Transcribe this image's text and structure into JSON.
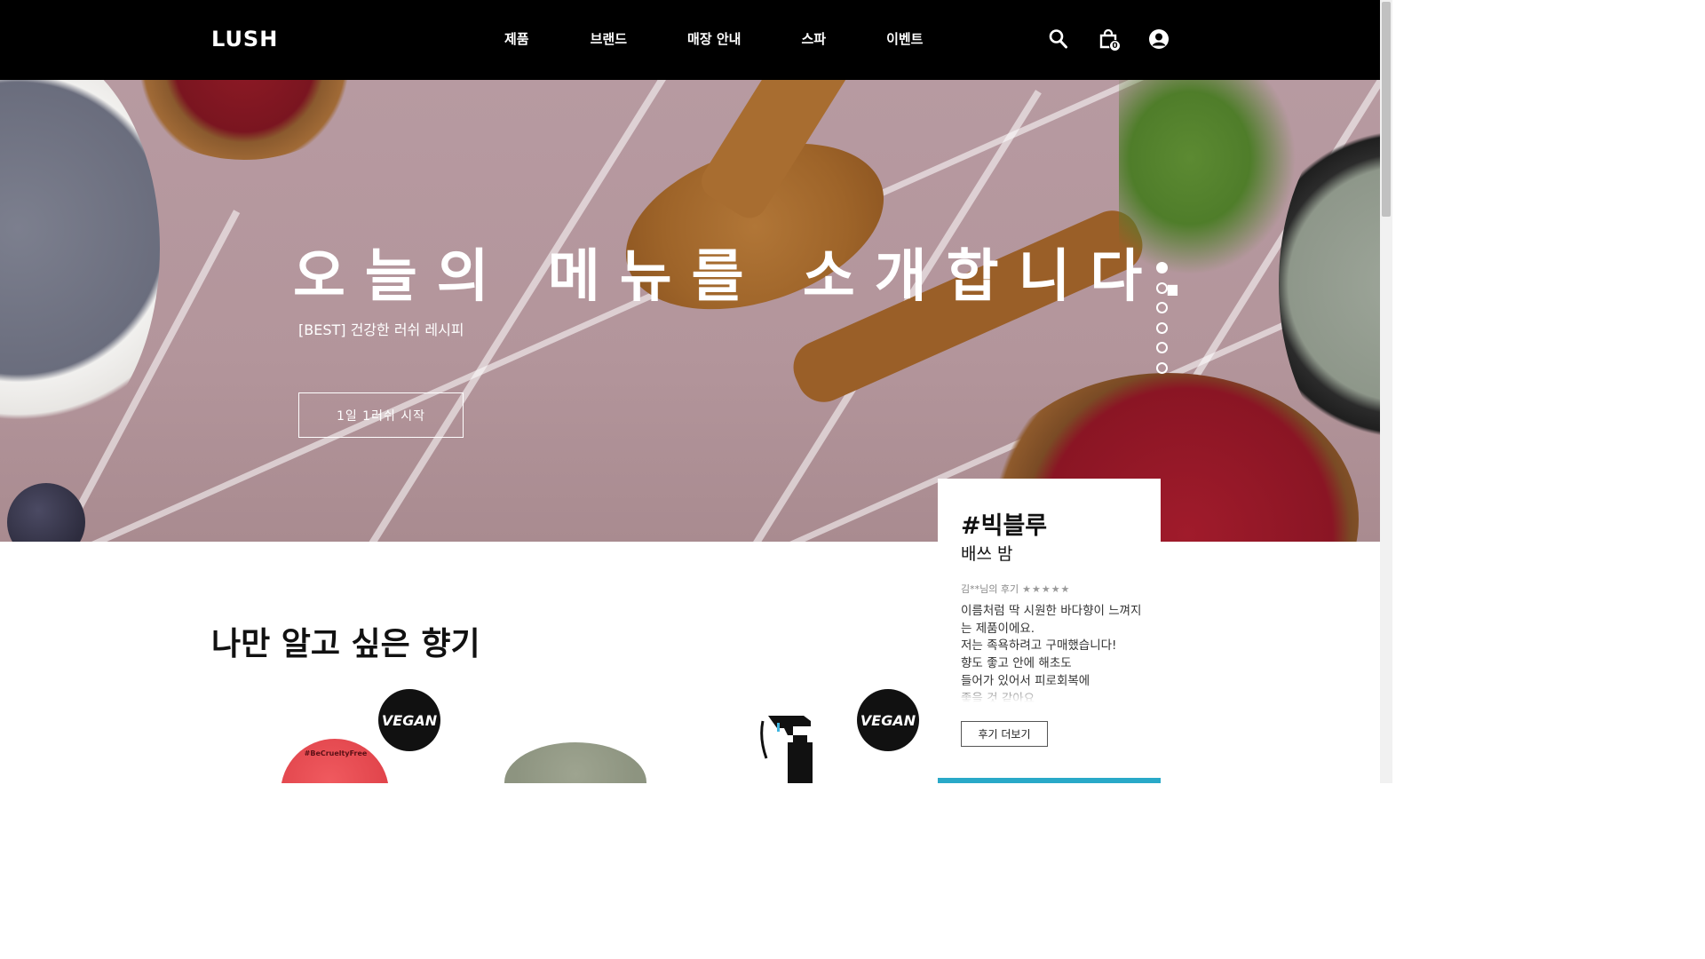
{
  "header": {
    "logo": "LUSH",
    "nav": [
      "제품",
      "브랜드",
      "매장 안내",
      "스파",
      "이벤트"
    ],
    "cart_count": "0",
    "icons": [
      "search-icon",
      "shopping-bag-icon",
      "user-icon"
    ]
  },
  "hero": {
    "title": "오늘의 메뉴를 소개합니다.",
    "subtitle": "[BEST] 건강한 러쉬 레시피",
    "button": "1일 1러쉬 시작",
    "slide_count": 6,
    "active_slide": 1
  },
  "section": {
    "title": "나만 알고 싶은 향기",
    "products": [
      {
        "vegan_badge": "VEGAN",
        "label_on_product": "#BeCrueltyFree"
      },
      {
        "vegan_badge": ""
      },
      {
        "vegan_badge": "VEGAN"
      }
    ]
  },
  "review": {
    "hashtag": "#빅블루",
    "product": "배쓰 밤",
    "author": "김**님의 후기",
    "rating": 5,
    "stars": "★★★★★",
    "body": "이름처럼 딱 시원한 바다향이 느껴지는 제품이에요.\n저는 족욕하려고 구매했습니다!\n향도 좋고 안에 해초도\n들어가 있어서 피로회복에\n좋을 것 같아요",
    "more_button": "후기 더보기"
  },
  "colors": {
    "header_bg": "#000000",
    "accent_bar": "#29a9c8",
    "hero_tile": "#b79aa1"
  }
}
